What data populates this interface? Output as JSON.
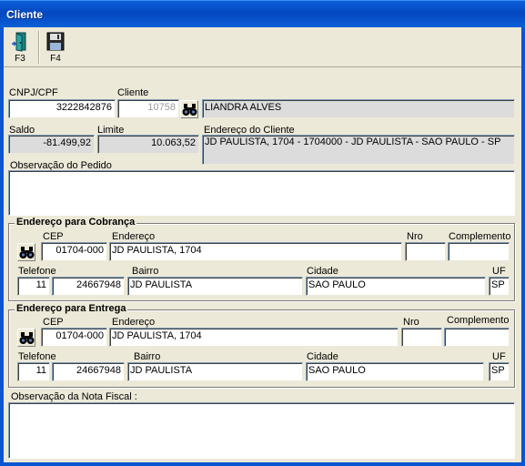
{
  "window": {
    "title": "Cliente"
  },
  "toolbar": {
    "exit": {
      "key": "F3",
      "icon": "exit-door-icon"
    },
    "save": {
      "key": "F4",
      "icon": "floppy-disk-icon"
    }
  },
  "customer": {
    "cnpj_label": "CNPJ/CPF",
    "cnpj_value": "3222842876",
    "cliente_label": "Cliente",
    "cliente_code": "10758",
    "cliente_name": "LIANDRA ALVES",
    "saldo_label": "Saldo",
    "saldo_value": "-81.499,92",
    "limite_label": "Limite",
    "limite_value": "10.063,52",
    "endereco_label": "Endereço do Cliente",
    "endereco_value": "JD PAULISTA, 1704  - 1704000  - JD PAULISTA  - SAO PAULO  - SP",
    "obs_pedido_label": "Observação do Pedido",
    "obs_pedido_value": ""
  },
  "cobranca": {
    "title": "Endereço para Cobrança",
    "cep_label": "CEP",
    "cep": "01704-000",
    "endereco_label": "Endereço",
    "endereco": "JD PAULISTA, 1704",
    "nro_label": "Nro",
    "nro": "",
    "complemento_label": "Complemento",
    "complemento": "",
    "telefone_label": "Telefone",
    "ddd": "11",
    "telefone": "24667948",
    "bairro_label": "Bairro",
    "bairro": "JD PAULISTA",
    "cidade_label": "Cidade",
    "cidade": "SAO PAULO",
    "uf_label": "UF",
    "uf": "SP"
  },
  "entrega": {
    "title": "Endereço para Entrega",
    "cep_label": "CEP",
    "cep": "01704-000",
    "endereco_label": "Endereço",
    "endereco": "JD PAULISTA, 1704",
    "nro_label": "Nro",
    "nro": "",
    "complemento_label": "Complemento",
    "complemento": "",
    "telefone_label": "Telefone",
    "ddd": "11",
    "telefone": "24667948",
    "bairro_label": "Bairro",
    "bairro": "JD PAULISTA",
    "cidade_label": "Cidade",
    "cidade": "SAO PAULO",
    "uf_label": "UF",
    "uf": "SP"
  },
  "nota_fiscal": {
    "obs_label": "Observação da Nota Fiscal :",
    "obs_value": ""
  },
  "icons": {
    "search": "binoculars-icon"
  }
}
